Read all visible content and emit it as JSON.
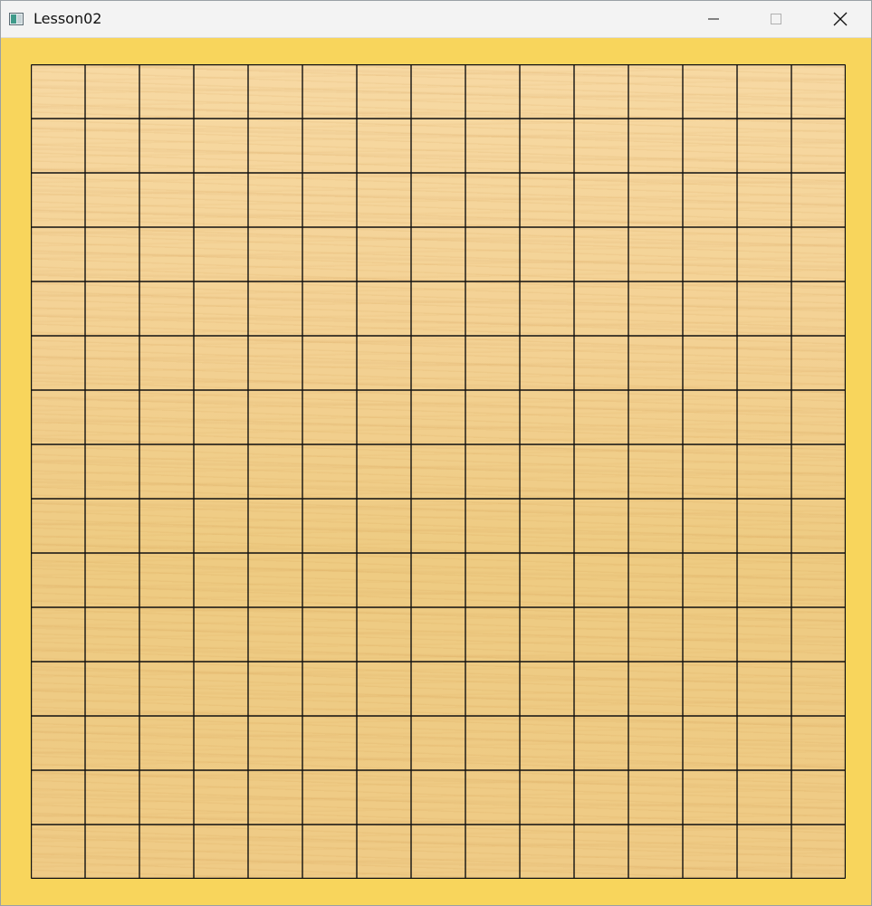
{
  "window": {
    "title": "Lesson02",
    "controls": {
      "minimize": "minimize-icon",
      "maximize": "maximize-icon",
      "close": "close-icon"
    }
  },
  "board": {
    "rows": 15,
    "cols": 15,
    "frame_color": "#f8d55c",
    "line_color": "#111111",
    "wood_color": "#f3d193"
  }
}
